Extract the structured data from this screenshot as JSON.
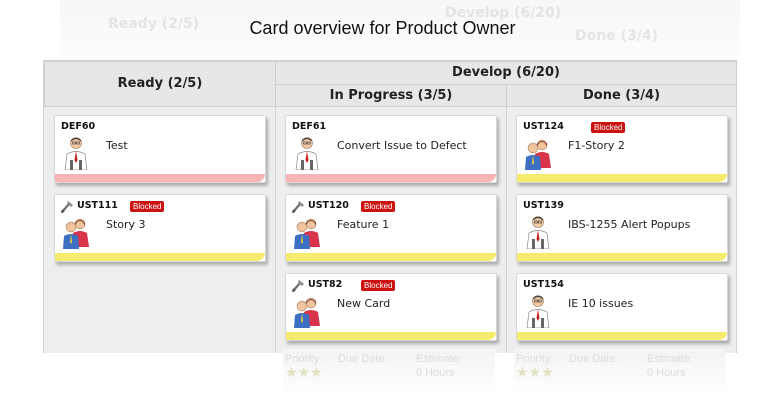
{
  "page_title": "Card overview for Product Owner",
  "ghost_header": {
    "ready": "Ready (2/5)",
    "develop": "Develop (6/20)",
    "done": "Done (3/4)"
  },
  "board": {
    "columns": {
      "ready": "Ready (2/5)",
      "develop": "Develop (6/20)",
      "in_progress": "In Progress (3/5)",
      "done": "Done (3/4)"
    },
    "ready_cards": [
      {
        "id": "DEF60",
        "title": "Test",
        "blocked": "",
        "type_icon": "",
        "avatar": "single-person-icon",
        "stripe": "#f7b6b6"
      },
      {
        "id": "UST111",
        "title": "Story 3",
        "blocked": "Blocked",
        "type_icon": "tool-icon",
        "avatar": "group-icon",
        "stripe": "#f5ec6e"
      }
    ],
    "in_progress_cards": [
      {
        "id": "DEF61",
        "title": "Convert Issue to Defect",
        "blocked": "",
        "type_icon": "",
        "avatar": "single-person-icon",
        "stripe": "#f7b6b6"
      },
      {
        "id": "UST120",
        "title": "Feature 1",
        "blocked": "Blocked",
        "type_icon": "tool-icon",
        "avatar": "group-icon",
        "stripe": "#f5ec6e"
      },
      {
        "id": "UST82",
        "title": "New Card",
        "blocked": "Blocked",
        "type_icon": "tool-icon",
        "avatar": "group-icon",
        "stripe": "#f5ec6e"
      }
    ],
    "done_cards": [
      {
        "id": "UST124",
        "title": "F1-Story 2",
        "blocked": "Blocked",
        "type_icon": "",
        "avatar": "group-icon",
        "stripe": "#f5ec6e"
      },
      {
        "id": "UST139",
        "title": "IBS-1255 Alert Popups",
        "blocked": "",
        "type_icon": "",
        "avatar": "single-person-icon",
        "stripe": "#f5ec6e"
      },
      {
        "id": "UST154",
        "title": "IE 10 issues",
        "blocked": "",
        "type_icon": "",
        "avatar": "single-person-icon",
        "stripe": "#f5ec6e"
      }
    ]
  },
  "ghost_footer": {
    "priority": "Priority:",
    "due_date": "Due Date:",
    "estimate": "Estimate:",
    "hours": "0 Hours"
  },
  "colors": {
    "blocked_badge": "#cc1111",
    "stripe_pink": "#f7b6b6",
    "stripe_yellow": "#f5ec6e"
  }
}
